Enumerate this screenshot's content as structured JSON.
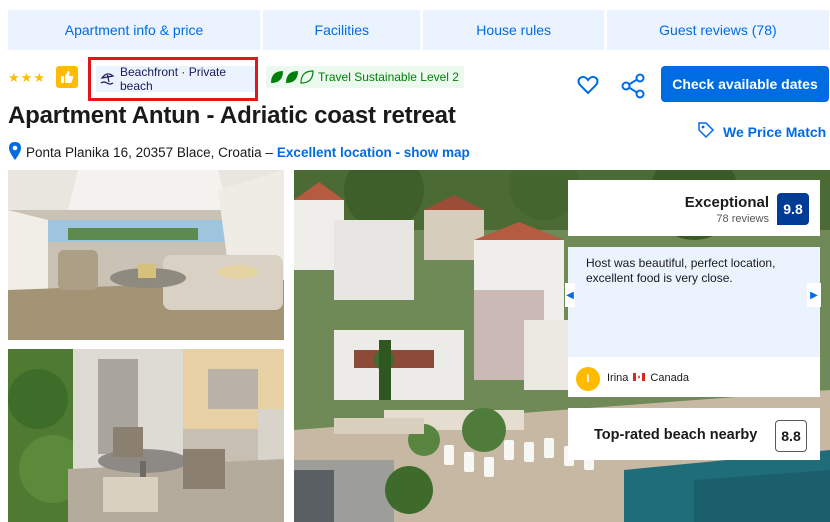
{
  "tabs": [
    {
      "label": "Apartment info & price"
    },
    {
      "label": "Facilities"
    },
    {
      "label": "House rules"
    },
    {
      "label": "Guest reviews (78)"
    }
  ],
  "property": {
    "star_rating": 3,
    "beach_badge": "Beachfront · Private beach",
    "sustainability_badge": "Travel Sustainable Level 2",
    "title": "Apartment Antun - Adriatic coast retreat",
    "address": "Ponta Planika 16, 20357 Blace, Croatia –",
    "location_link": "Excellent location - show map"
  },
  "actions": {
    "check_dates_label": "Check available dates",
    "price_match_label": "We Price Match"
  },
  "rating": {
    "label": "Exceptional",
    "reviews_count": "78 reviews",
    "score": "9.8"
  },
  "review": {
    "text": "Host was beautiful, perfect location, excellent food is very close.",
    "avatar_initial": "I",
    "reviewer_name": "Irina",
    "reviewer_country": "Canada"
  },
  "beach": {
    "label": "Top-rated beach nearby",
    "score": "8.8"
  },
  "colors": {
    "brand_blue": "#006ce4",
    "dark_blue": "#003b95",
    "tab_background": "#ebf3ff",
    "star_yellow": "#febb02",
    "sustain_green": "#00800a",
    "highlight_red": "#e0161b"
  },
  "icons": [
    "star-icon",
    "thumbs-up-icon",
    "beach-umbrella-icon",
    "leaf-icon",
    "heart-icon",
    "share-icon",
    "price-tag-icon",
    "map-pin-icon",
    "chevron-left-icon",
    "chevron-right-icon"
  ]
}
